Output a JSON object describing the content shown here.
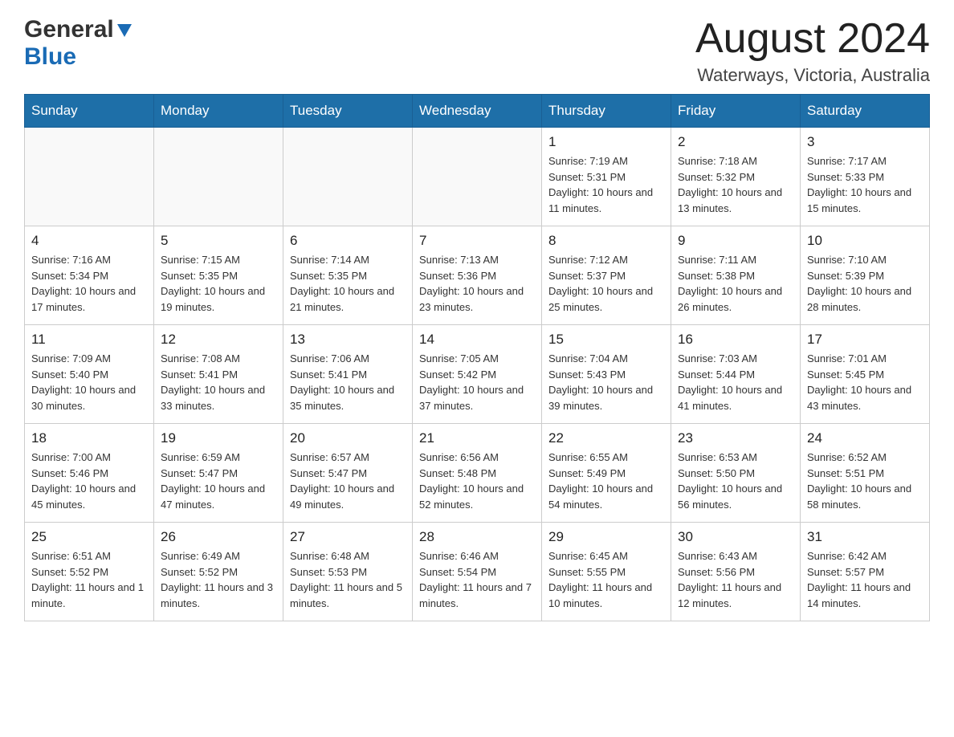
{
  "header": {
    "logo_general": "General",
    "logo_blue": "Blue",
    "month_title": "August 2024",
    "location": "Waterways, Victoria, Australia"
  },
  "days_of_week": [
    "Sunday",
    "Monday",
    "Tuesday",
    "Wednesday",
    "Thursday",
    "Friday",
    "Saturday"
  ],
  "weeks": [
    {
      "days": [
        {
          "num": "",
          "info": ""
        },
        {
          "num": "",
          "info": ""
        },
        {
          "num": "",
          "info": ""
        },
        {
          "num": "",
          "info": ""
        },
        {
          "num": "1",
          "info": "Sunrise: 7:19 AM\nSunset: 5:31 PM\nDaylight: 10 hours and 11 minutes."
        },
        {
          "num": "2",
          "info": "Sunrise: 7:18 AM\nSunset: 5:32 PM\nDaylight: 10 hours and 13 minutes."
        },
        {
          "num": "3",
          "info": "Sunrise: 7:17 AM\nSunset: 5:33 PM\nDaylight: 10 hours and 15 minutes."
        }
      ]
    },
    {
      "days": [
        {
          "num": "4",
          "info": "Sunrise: 7:16 AM\nSunset: 5:34 PM\nDaylight: 10 hours and 17 minutes."
        },
        {
          "num": "5",
          "info": "Sunrise: 7:15 AM\nSunset: 5:35 PM\nDaylight: 10 hours and 19 minutes."
        },
        {
          "num": "6",
          "info": "Sunrise: 7:14 AM\nSunset: 5:35 PM\nDaylight: 10 hours and 21 minutes."
        },
        {
          "num": "7",
          "info": "Sunrise: 7:13 AM\nSunset: 5:36 PM\nDaylight: 10 hours and 23 minutes."
        },
        {
          "num": "8",
          "info": "Sunrise: 7:12 AM\nSunset: 5:37 PM\nDaylight: 10 hours and 25 minutes."
        },
        {
          "num": "9",
          "info": "Sunrise: 7:11 AM\nSunset: 5:38 PM\nDaylight: 10 hours and 26 minutes."
        },
        {
          "num": "10",
          "info": "Sunrise: 7:10 AM\nSunset: 5:39 PM\nDaylight: 10 hours and 28 minutes."
        }
      ]
    },
    {
      "days": [
        {
          "num": "11",
          "info": "Sunrise: 7:09 AM\nSunset: 5:40 PM\nDaylight: 10 hours and 30 minutes."
        },
        {
          "num": "12",
          "info": "Sunrise: 7:08 AM\nSunset: 5:41 PM\nDaylight: 10 hours and 33 minutes."
        },
        {
          "num": "13",
          "info": "Sunrise: 7:06 AM\nSunset: 5:41 PM\nDaylight: 10 hours and 35 minutes."
        },
        {
          "num": "14",
          "info": "Sunrise: 7:05 AM\nSunset: 5:42 PM\nDaylight: 10 hours and 37 minutes."
        },
        {
          "num": "15",
          "info": "Sunrise: 7:04 AM\nSunset: 5:43 PM\nDaylight: 10 hours and 39 minutes."
        },
        {
          "num": "16",
          "info": "Sunrise: 7:03 AM\nSunset: 5:44 PM\nDaylight: 10 hours and 41 minutes."
        },
        {
          "num": "17",
          "info": "Sunrise: 7:01 AM\nSunset: 5:45 PM\nDaylight: 10 hours and 43 minutes."
        }
      ]
    },
    {
      "days": [
        {
          "num": "18",
          "info": "Sunrise: 7:00 AM\nSunset: 5:46 PM\nDaylight: 10 hours and 45 minutes."
        },
        {
          "num": "19",
          "info": "Sunrise: 6:59 AM\nSunset: 5:47 PM\nDaylight: 10 hours and 47 minutes."
        },
        {
          "num": "20",
          "info": "Sunrise: 6:57 AM\nSunset: 5:47 PM\nDaylight: 10 hours and 49 minutes."
        },
        {
          "num": "21",
          "info": "Sunrise: 6:56 AM\nSunset: 5:48 PM\nDaylight: 10 hours and 52 minutes."
        },
        {
          "num": "22",
          "info": "Sunrise: 6:55 AM\nSunset: 5:49 PM\nDaylight: 10 hours and 54 minutes."
        },
        {
          "num": "23",
          "info": "Sunrise: 6:53 AM\nSunset: 5:50 PM\nDaylight: 10 hours and 56 minutes."
        },
        {
          "num": "24",
          "info": "Sunrise: 6:52 AM\nSunset: 5:51 PM\nDaylight: 10 hours and 58 minutes."
        }
      ]
    },
    {
      "days": [
        {
          "num": "25",
          "info": "Sunrise: 6:51 AM\nSunset: 5:52 PM\nDaylight: 11 hours and 1 minute."
        },
        {
          "num": "26",
          "info": "Sunrise: 6:49 AM\nSunset: 5:52 PM\nDaylight: 11 hours and 3 minutes."
        },
        {
          "num": "27",
          "info": "Sunrise: 6:48 AM\nSunset: 5:53 PM\nDaylight: 11 hours and 5 minutes."
        },
        {
          "num": "28",
          "info": "Sunrise: 6:46 AM\nSunset: 5:54 PM\nDaylight: 11 hours and 7 minutes."
        },
        {
          "num": "29",
          "info": "Sunrise: 6:45 AM\nSunset: 5:55 PM\nDaylight: 11 hours and 10 minutes."
        },
        {
          "num": "30",
          "info": "Sunrise: 6:43 AM\nSunset: 5:56 PM\nDaylight: 11 hours and 12 minutes."
        },
        {
          "num": "31",
          "info": "Sunrise: 6:42 AM\nSunset: 5:57 PM\nDaylight: 11 hours and 14 minutes."
        }
      ]
    }
  ]
}
